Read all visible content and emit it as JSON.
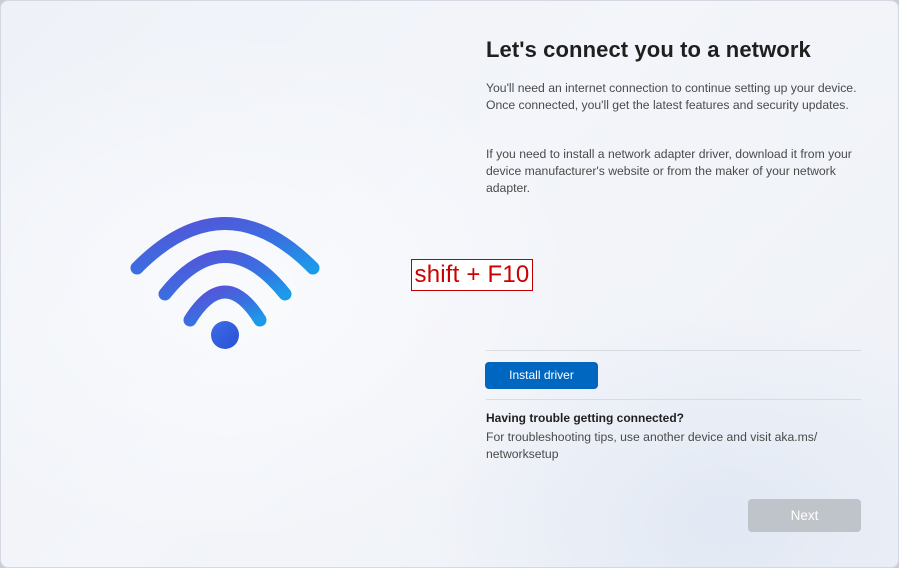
{
  "page": {
    "title": "Let's connect you to a network",
    "paragraphs": [
      "You'll need an internet connection to continue setting up your device. Once connected, you'll get the latest features and security updates.",
      "If you need to install a network adapter driver, download it from your device manufacturer's website or from the maker of your network adapter."
    ]
  },
  "illustration": {
    "icon": "wifi-icon",
    "gradient_colors": [
      "#4f56d9",
      "#2f7fe0",
      "#1a93e8"
    ]
  },
  "annotation": {
    "label": "shift + F10",
    "color": "#cc0000"
  },
  "actions": {
    "install_driver_label": "Install driver",
    "install_driver_color": "#0067c0",
    "next_label": "Next",
    "next_state": "disabled"
  },
  "troubleshooting": {
    "heading": "Having trouble getting connected?",
    "text": "For troubleshooting tips, use another device and visit aka.ms/ networksetup"
  }
}
